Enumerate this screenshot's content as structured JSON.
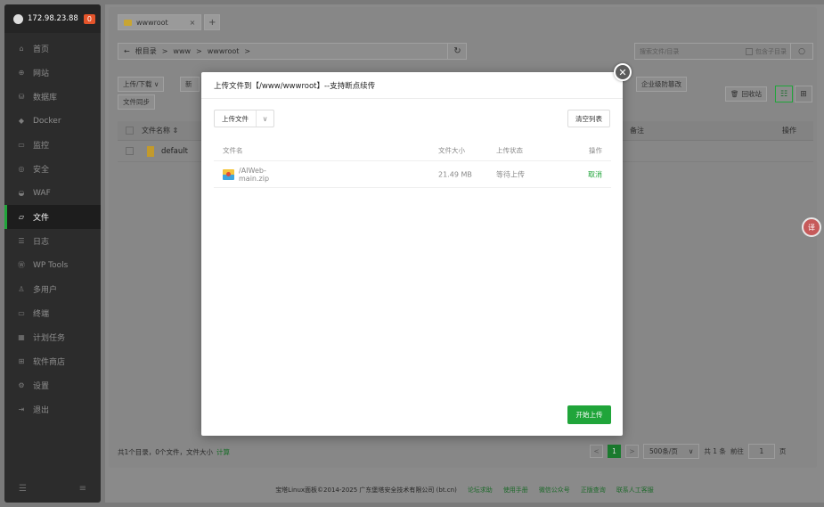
{
  "sidebar": {
    "server_ip": "172.98.23.88",
    "alert_count": "0",
    "items": [
      {
        "icon": "home-icon",
        "glyph": "⌂",
        "label": "首页"
      },
      {
        "icon": "globe-icon",
        "glyph": "⊕",
        "label": "网站"
      },
      {
        "icon": "database-icon",
        "glyph": "⛁",
        "label": "数据库"
      },
      {
        "icon": "docker-icon",
        "glyph": "◆",
        "label": "Docker"
      },
      {
        "icon": "monitor-icon",
        "glyph": "▭",
        "label": "监控"
      },
      {
        "icon": "shield-icon",
        "glyph": "◎",
        "label": "安全"
      },
      {
        "icon": "waf-icon",
        "glyph": "◒",
        "label": "WAF"
      },
      {
        "icon": "folder-icon",
        "glyph": "▱",
        "label": "文件"
      },
      {
        "icon": "log-icon",
        "glyph": "☰",
        "label": "日志"
      },
      {
        "icon": "wordpress-icon",
        "glyph": "Ⓦ",
        "label": "WP Tools"
      },
      {
        "icon": "users-icon",
        "glyph": "♙",
        "label": "多用户"
      },
      {
        "icon": "terminal-icon",
        "glyph": "▭",
        "label": "终端"
      },
      {
        "icon": "calendar-icon",
        "glyph": "▦",
        "label": "计划任务"
      },
      {
        "icon": "apps-icon",
        "glyph": "⊞",
        "label": "软件商店"
      },
      {
        "icon": "settings-icon",
        "glyph": "⚙",
        "label": "设置"
      },
      {
        "icon": "logout-icon",
        "glyph": "⇥",
        "label": "退出"
      }
    ],
    "active_index": 7
  },
  "tabs": {
    "current": "wwwroot",
    "close": "×",
    "add": "+"
  },
  "address_bar": {
    "back": "←",
    "segments": [
      "根目录",
      "www",
      "wwwroot"
    ],
    "separator": ">",
    "refresh": "↻"
  },
  "search": {
    "placeholder": "搜索文件/目录",
    "include_subdir": "包含子目录"
  },
  "toolbar": {
    "upload_download": "上传/下载 ∨",
    "new": "新",
    "file_sync": "文件同步",
    "enterprise_tamper": "企业级防篡改",
    "recycle_bin": "回收站"
  },
  "table": {
    "col_name": "文件名称 ⇕",
    "col_remark": "备注",
    "col_action": "操作",
    "rows": [
      {
        "name": "default"
      }
    ]
  },
  "footer": {
    "summary": "共1个目录，0个文件，文件大小",
    "calc": "计算",
    "prev": "<",
    "page": "1",
    "next": ">",
    "page_size": "500条/页",
    "total": "共 1 条",
    "goto_label": "前往",
    "goto_value": "1",
    "page_unit": "页"
  },
  "copyright": {
    "text": "宝塔Linux面板©2014-2025 广东堡塔安全技术有限公司 (bt.cn)",
    "links": [
      "论坛求助",
      "使用手册",
      "微信公众号",
      "正版查询",
      "联系人工客服"
    ]
  },
  "modal": {
    "title": "上传文件到【/www/wwwroot】--支持断点续传",
    "upload_select": "上传文件",
    "clear_list": "清空列表",
    "col_name": "文件名",
    "col_size": "文件大小",
    "col_status": "上传状态",
    "col_action": "操作",
    "files": [
      {
        "name": "/AIWeb-main.zip",
        "size": "21.49 MB",
        "status": "等待上传",
        "action": "取消"
      }
    ],
    "start_upload": "开始上传",
    "close": "✕"
  },
  "translate_fab": "译",
  "colors": {
    "accent": "#20a53a",
    "badge": "#e5542a",
    "sidebar_bg": "#2c2c2c"
  }
}
